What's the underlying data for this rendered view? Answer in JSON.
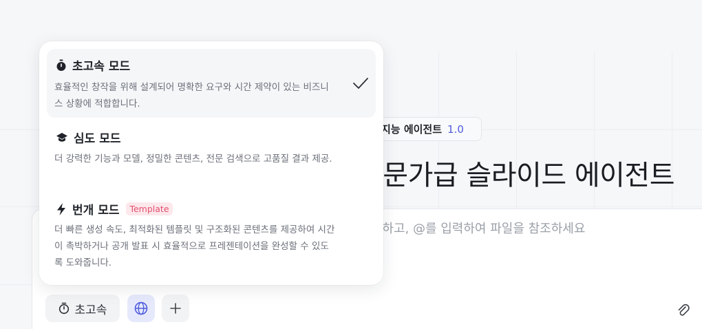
{
  "colors": {
    "accent": "#4f5bdc",
    "tag_text": "#e4506d",
    "tag_bg": "#fde8ec"
  },
  "background": {
    "badge_name": "지능 에이전트",
    "badge_version": "1.0",
    "title": "전문가급 슬라이드 에이전트",
    "input_placeholder": "을 입력하고, @를 입력하여 파일을 참조하세요"
  },
  "toolbar": {
    "mode_label": "초고속",
    "mode_icon": "stopwatch-icon",
    "globe_icon": "globe-icon",
    "add_icon": "plus-icon",
    "attach_icon": "attachment-icon"
  },
  "mode_menu": {
    "options": [
      {
        "title": "초고속 모드",
        "icon": "stopwatch-icon",
        "description": "효율적인 창작을 위해 설계되어 명확한 요구와 시간 제약이 있는 비즈니스 상황에 적합합니다.",
        "selected": true
      },
      {
        "title": "심도 모드",
        "icon": "graduation-cap-icon",
        "description": "더 강력한 기능과 모델, 정밀한 콘텐츠, 전문 검색으로 고품질 결과 제공.",
        "selected": false
      },
      {
        "title": "번개 모드",
        "icon": "lightning-icon",
        "tag": "Template",
        "description": "더 빠른 생성 속도, 최적화된 템플릿 및 구조화된 콘텐츠를 제공하여 시간이 촉박하거나 공개 발표 시 효율적으로 프레젠테이션을 완성할 수 있도록 도와줍니다.",
        "selected": false
      }
    ]
  }
}
